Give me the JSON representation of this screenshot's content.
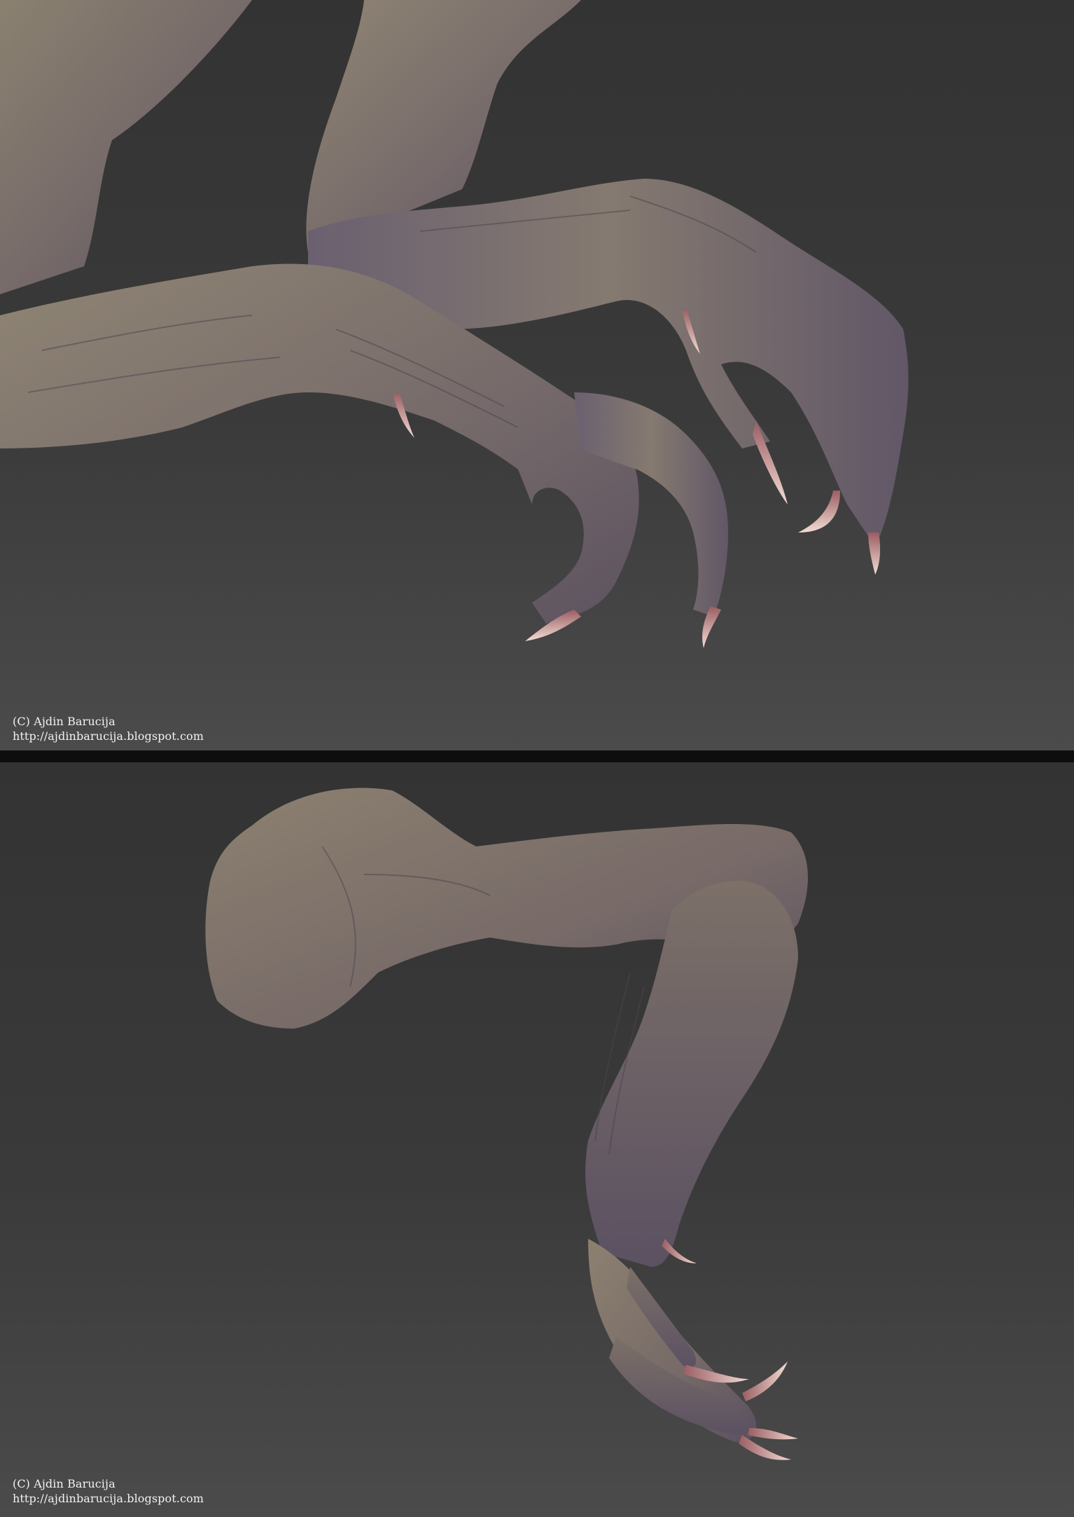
{
  "panels": [
    {
      "name": "top-render",
      "caption": {
        "copyright": "(C) Ajdin Barucija",
        "url": "http://ajdinbarucija.blogspot.com"
      }
    },
    {
      "name": "bottom-render",
      "caption": {
        "copyright": "(C) Ajdin Barucija",
        "url": "http://ajdinbarucija.blogspot.com"
      }
    }
  ],
  "colors": {
    "background_top": "#333333",
    "background_bottom": "#4b4b4b",
    "separator": "#0e0e0e",
    "skin_light": "#8d8270",
    "skin_dark": "#5c5360",
    "claw": "#e8c8c0",
    "caption_text": "#f2f2f2"
  },
  "subject": "creature-limb-render"
}
